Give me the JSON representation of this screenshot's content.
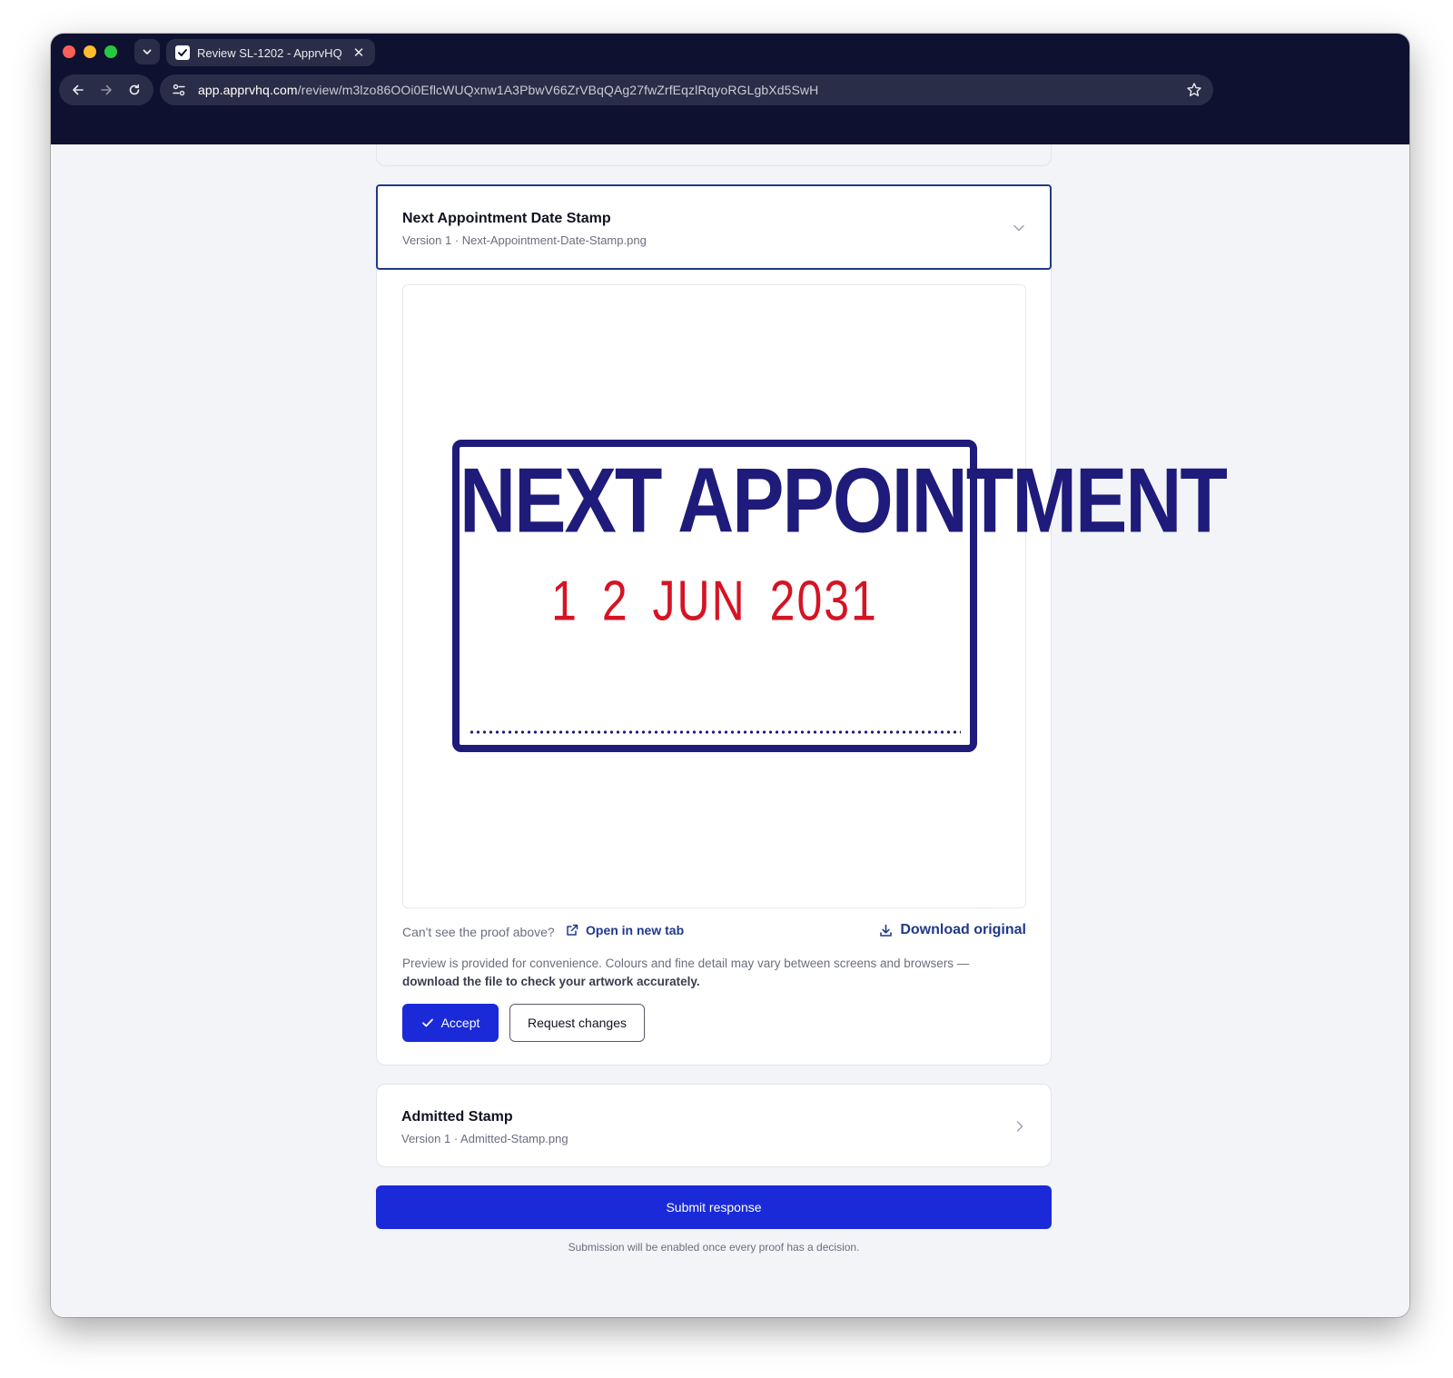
{
  "browser": {
    "tab_title": "Review SL-1202 - ApprvHQ",
    "url_host": "app.apprvhq.com",
    "url_path": "/review/m3lzo86OOi0EflcWUQxnw1A3PbwV66ZrVBqQAg27fwZrfEqzlRqyoRGLgbXd5SwH",
    "icons": {
      "tab_menu": "chevron-down-icon",
      "favicon": "checkbox-icon",
      "close": "close-icon",
      "back": "arrow-left-icon",
      "forward": "arrow-right-icon",
      "reload": "reload-icon",
      "site_info": "tune-icon",
      "bookmark": "star-icon"
    }
  },
  "proofs": [
    {
      "title": "Next Appointment Date Stamp",
      "subtitle": "Version 1 · Next-Appointment-Date-Stamp.png",
      "expanded": true,
      "artwork": {
        "headline": "NEXT APPOINTMENT",
        "date": "1 2  JUN  2031"
      },
      "help_question": "Can't see the proof above?",
      "open_link": "Open in new tab",
      "download_link": "Download original",
      "note_regular": "Preview is provided for convenience. Colours and fine detail may vary between screens and browsers —",
      "note_strong": "download the file to check your artwork accurately.",
      "accept_label": "Accept",
      "request_changes_label": "Request changes"
    },
    {
      "title": "Admitted Stamp",
      "subtitle": "Version 1 · Admitted-Stamp.png",
      "expanded": false
    }
  ],
  "footer": {
    "submit_label": "Submit response",
    "submit_hint": "Submission will be enabled once every proof has a decision."
  },
  "colors": {
    "chrome": "#0e1130",
    "accent": "#1a2ad9",
    "link": "#1f3a8a",
    "stamp_ink": "#1f1b7a",
    "stamp_date": "#d41424"
  }
}
